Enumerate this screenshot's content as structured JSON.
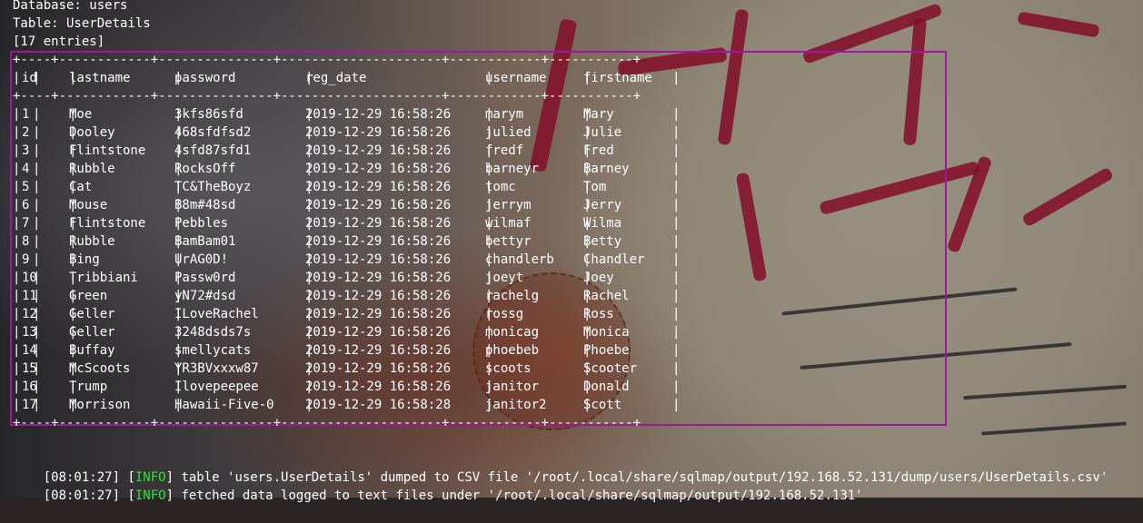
{
  "header": {
    "database_line": "Database: users",
    "table_line": "Table: UserDetails",
    "entries_line": "[17 entries]"
  },
  "table": {
    "border_top": "+----+------------+---------------+---------------------+------------+-----------+",
    "border_mid": "+----+------------+---------------+---------------------+------------+-----------+",
    "border_bottom": "+----+------------+---------------+---------------------+------------+-----------+",
    "columns": [
      "id",
      "lastname",
      "password",
      "reg_date",
      "username",
      "firstname"
    ],
    "rows": [
      [
        "1",
        "Moe",
        "3kfs86sfd",
        "2019-12-29 16:58:26",
        "marym",
        "Mary"
      ],
      [
        "2",
        "Dooley",
        "468sfdfsd2",
        "2019-12-29 16:58:26",
        "julied",
        "Julie"
      ],
      [
        "3",
        "Flintstone",
        "4sfd87sfd1",
        "2019-12-29 16:58:26",
        "fredf",
        "Fred"
      ],
      [
        "4",
        "Rubble",
        "RocksOff",
        "2019-12-29 16:58:26",
        "barneyr",
        "Barney"
      ],
      [
        "5",
        "Cat",
        "TC&TheBoyz",
        "2019-12-29 16:58:26",
        "tomc",
        "Tom"
      ],
      [
        "6",
        "Mouse",
        "B8m#48sd",
        "2019-12-29 16:58:26",
        "jerrym",
        "Jerry"
      ],
      [
        "7",
        "Flintstone",
        "Pebbles",
        "2019-12-29 16:58:26",
        "wilmaf",
        "Wilma"
      ],
      [
        "8",
        "Rubble",
        "BamBam01",
        "2019-12-29 16:58:26",
        "bettyr",
        "Betty"
      ],
      [
        "9",
        "Bing",
        "UrAG0D!",
        "2019-12-29 16:58:26",
        "chandlerb",
        "Chandler"
      ],
      [
        "10",
        "Tribbiani",
        "Passw0rd",
        "2019-12-29 16:58:26",
        "joeyt",
        "Joey"
      ],
      [
        "11",
        "Green",
        "yN72#dsd",
        "2019-12-29 16:58:26",
        "rachelg",
        "Rachel"
      ],
      [
        "12",
        "Geller",
        "ILoveRachel",
        "2019-12-29 16:58:26",
        "rossg",
        "Ross"
      ],
      [
        "13",
        "Geller",
        "3248dsds7s",
        "2019-12-29 16:58:26",
        "monicag",
        "Monica"
      ],
      [
        "14",
        "Buffay",
        "smellycats",
        "2019-12-29 16:58:26",
        "phoebeb",
        "Phoebe"
      ],
      [
        "15",
        "McScoots",
        "YR3BVxxxw87",
        "2019-12-29 16:58:26",
        "scoots",
        "Scooter"
      ],
      [
        "16",
        "Trump",
        "Ilovepeepee",
        "2019-12-29 16:58:26",
        "janitor",
        "Donald"
      ],
      [
        "17",
        "Morrison",
        "Hawaii-Five-0",
        "2019-12-29 16:58:28",
        "janitor2",
        "Scott"
      ]
    ]
  },
  "log": [
    {
      "time": "[08:01:27]",
      "tag_open": " [",
      "tag": "INFO",
      "tag_close": "] ",
      "text": "table 'users.UserDetails' dumped to CSV file '/root/.local/share/sqlmap/output/192.168.52.131/dump/users/UserDetails.csv'"
    },
    {
      "time": "[08:01:27]",
      "tag_open": " [",
      "tag": "INFO",
      "tag_close": "] ",
      "text": "fetched data logged to text files under '/root/.local/share/sqlmap/output/192.168.52.131'"
    }
  ],
  "colors": {
    "terminal_text": "#ffffff",
    "info_tag": "#34e034",
    "selection_border": "#9a1a9a"
  }
}
